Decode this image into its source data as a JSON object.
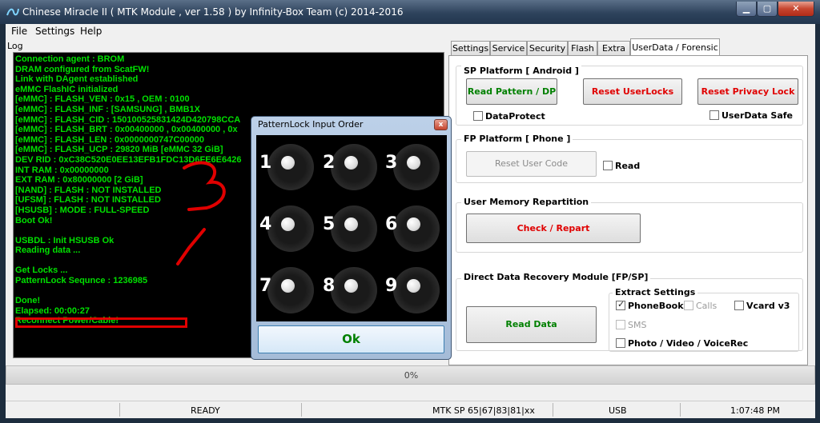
{
  "window": {
    "title": "Chinese Miracle II ( MTK Module , ver 1.58 ) by Infinity-Box Team (c) 2014-2016",
    "min_glyph": "▁",
    "max_glyph": "▢",
    "close_glyph": "✕"
  },
  "menu": [
    "File",
    "Settings",
    "Help"
  ],
  "log": {
    "label": "Log",
    "lines": [
      "Connection agent : BROM",
      "DRAM configured from ScatFW!",
      "Link with DAgent established",
      "eMMC FlashIC initialized",
      "[eMMC] : FLASH_VEN : 0x15 , OEM : 0100",
      "[eMMC] : FLASH_INF : [SAMSUNG] , BMB1X",
      "[eMMC] : FLASH_CID : 150100525831424D420798CCA",
      "[eMMC] : FLASH_BRT : 0x00400000 , 0x00400000 , 0x",
      "[eMMC] : FLASH_LEN : 0x0000000747C00000",
      "[eMMC] : FLASH_UCP : 29820 MiB [eMMC 32 GiB]",
      "DEV RID    : 0xC38C520E0EE13EFB1FDC13D6FE6E6426",
      "INT RAM    : 0x00000000",
      "EXT RAM    : 0x80000000 [2 GiB]",
      "[NAND] : FLASH : NOT INSTALLED",
      "[UFSM] : FLASH : NOT INSTALLED",
      "[HSUSB] : MODE : FULL-SPEED",
      "Boot Ok!",
      "",
      "USBDL : Init HSUSB Ok",
      "Reading data ...",
      "",
      "Get Locks ...",
      "PatternLock Sequnce : 1236985",
      "",
      "Done!",
      "Elapsed: 00:00:27",
      "Reconnect Power/Cable!"
    ],
    "handwritten_annotation": "3",
    "annotation_color": "#e00000"
  },
  "tabs": [
    "Settings",
    "Service",
    "Security",
    "Flash",
    "Extra",
    "UserData / Forensic"
  ],
  "active_tab": "UserData / Forensic",
  "sp_platform": {
    "title": "SP Platform [ Android ]",
    "read_pattern": "Read Pattern / DP",
    "reset_userlocks": "Reset UserLocks",
    "reset_privacy": "Reset Privacy Lock",
    "dataprotect": "DataProtect",
    "userdata_safe": "UserData Safe"
  },
  "fp_platform": {
    "title": "FP Platform [ Phone ]",
    "reset_user_code": "Reset User Code",
    "read": "Read"
  },
  "user_memory": {
    "title": "User Memory Repartition",
    "check_repart": "Check / Repart"
  },
  "data_recovery": {
    "title": "Direct Data Recovery Module  [FP/SP]",
    "read_data": "Read Data",
    "extract_title": "Extract Settings",
    "phonebook": "PhoneBook",
    "calls": "Calls",
    "vcard": "Vcard v3",
    "sms": "SMS",
    "media": "Photo / Video / VoiceRec",
    "phonebook_checked": true,
    "vcard_checked": false,
    "media_checked": false
  },
  "progress": {
    "text": "0%",
    "value": 0
  },
  "statusbar": {
    "state": "READY",
    "platform": "MTK SP 65|67|83|81|xx",
    "port": "USB",
    "time": "1:07:48 PM"
  },
  "dialog": {
    "title": "PatternLock Input Order",
    "close_glyph": "x",
    "nodes": [
      "1",
      "2",
      "3",
      "4",
      "5",
      "6",
      "7",
      "8",
      "9"
    ],
    "ok": "Ok"
  },
  "colors": {
    "log_text": "#00e000",
    "action_green": "#008000",
    "action_red": "#e00000"
  }
}
